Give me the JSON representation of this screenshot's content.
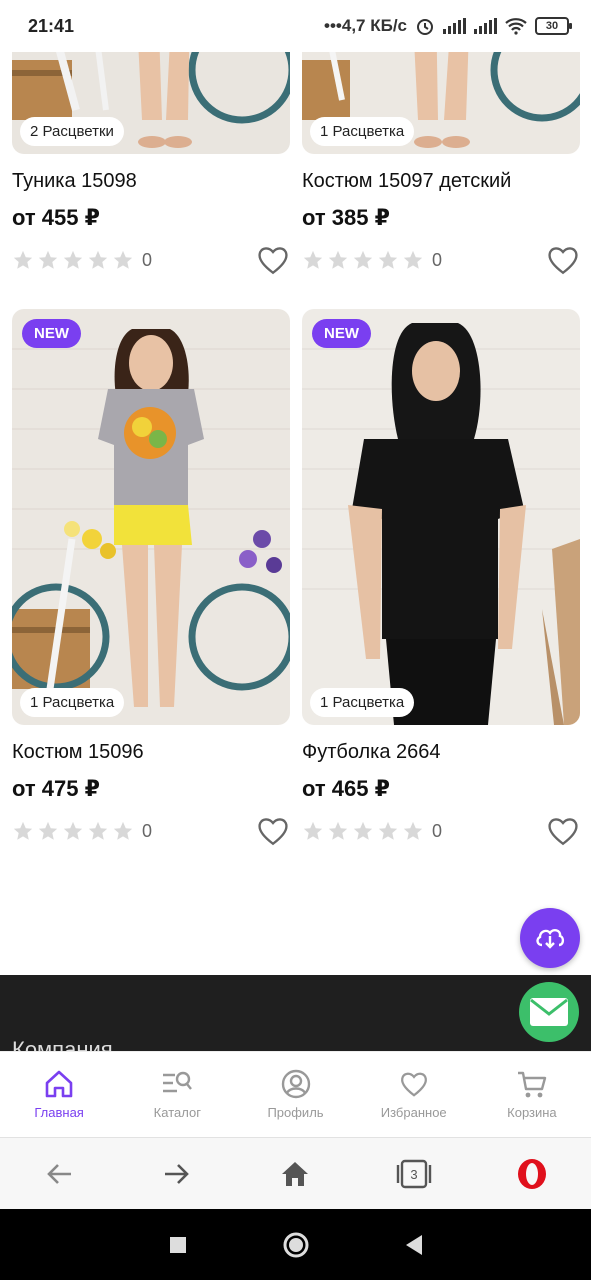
{
  "status_bar": {
    "time": "21:41",
    "net_speed": "•••4,7 КБ/с",
    "battery": "30"
  },
  "products": [
    {
      "title": "Туника 15098",
      "price": "от 455 ₽",
      "colors": "2 Расцветки",
      "rating_count": "0",
      "is_new": false
    },
    {
      "title": "Костюм 15097 детский",
      "price": "от 385 ₽",
      "colors": "1 Расцветка",
      "rating_count": "0",
      "is_new": false
    },
    {
      "title": "Костюм 15096",
      "price": "от 475 ₽",
      "colors": "1 Расцветка",
      "rating_count": "0",
      "is_new": true,
      "new_label": "NEW"
    },
    {
      "title": "Футболка 2664",
      "price": "от 465 ₽",
      "colors": "1 Расцветка",
      "rating_count": "0",
      "is_new": true,
      "new_label": "NEW"
    }
  ],
  "footer": {
    "company_label": "Компания"
  },
  "app_nav": [
    {
      "label": "Главная",
      "icon": "home-icon",
      "active": true
    },
    {
      "label": "Каталог",
      "icon": "catalog-search-icon",
      "active": false
    },
    {
      "label": "Профиль",
      "icon": "profile-icon",
      "active": false
    },
    {
      "label": "Избранное",
      "icon": "heart-icon",
      "active": false
    },
    {
      "label": "Корзина",
      "icon": "cart-icon",
      "active": false
    }
  ],
  "browser_bar": {
    "tabs_count": "3",
    "icons": [
      "back-arrow-icon",
      "forward-arrow-icon",
      "home-icon",
      "tabs-icon",
      "opera-icon"
    ]
  },
  "colors": {
    "accent": "#7a3ff0",
    "mail_fab": "#3cbf6a",
    "footer_dark": "#1f1f1f"
  }
}
